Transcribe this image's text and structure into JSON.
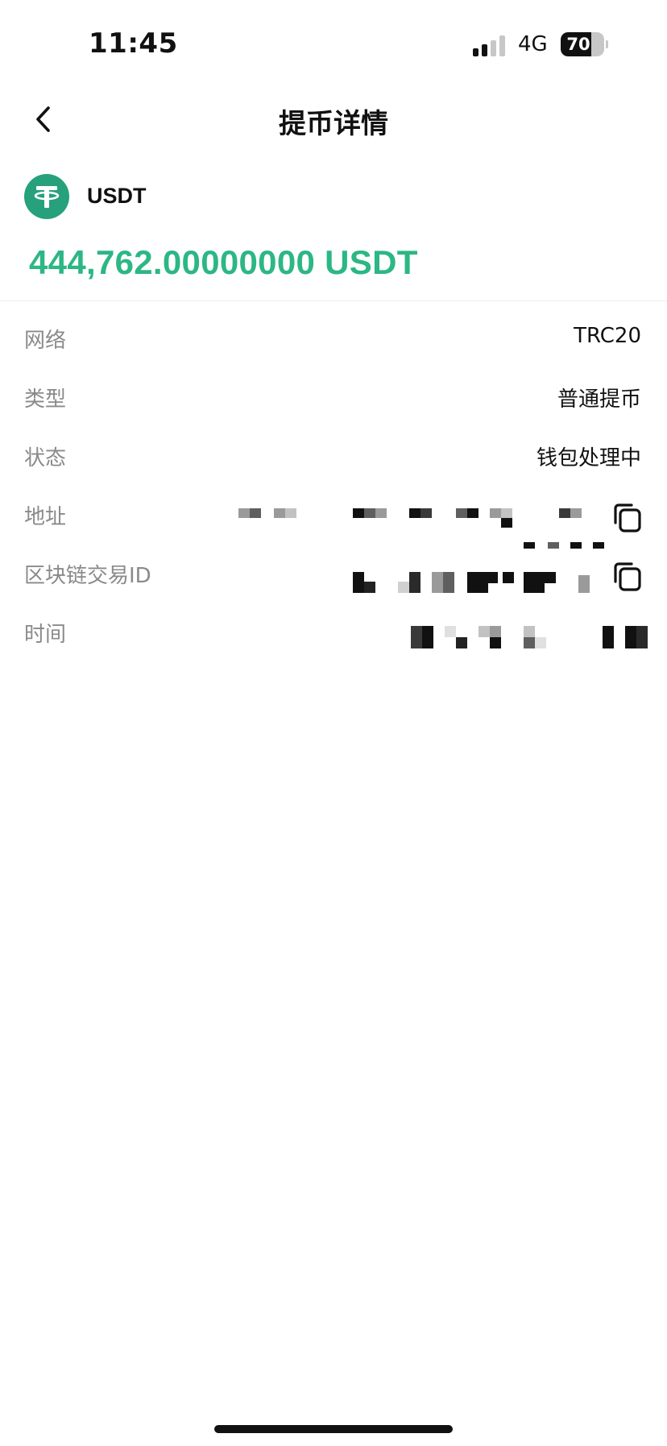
{
  "status_bar": {
    "time": "11:45",
    "network": "4G",
    "battery_level": "70",
    "battery_fraction": 0.7
  },
  "nav": {
    "title": "提币详情",
    "back_icon": "chevron-left-icon"
  },
  "coin": {
    "name": "USDT",
    "logo_icon": "tether-logo",
    "logo_color": "#26a17b"
  },
  "amount": {
    "value": "444,762.00000000",
    "unit": "USDT",
    "color": "#2cb785"
  },
  "details": [
    {
      "label": "网络",
      "value": "TRC20"
    },
    {
      "label": "类型",
      "value": "普通提币"
    },
    {
      "label": "状态",
      "value": "钱包处理中"
    },
    {
      "label": "地址",
      "value": ""
    },
    {
      "label": "区块链交易ID",
      "value": ""
    },
    {
      "label": "时间",
      "value": ""
    }
  ]
}
